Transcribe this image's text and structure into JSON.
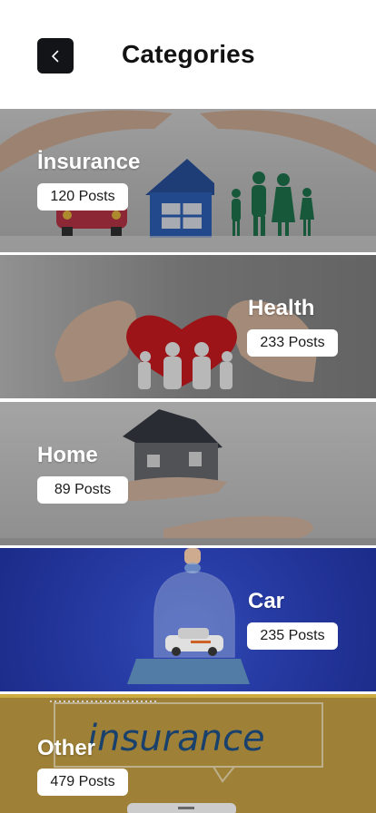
{
  "header": {
    "title": "Categories",
    "back_icon": "chevron-left-icon"
  },
  "categories": [
    {
      "name": "İnsurance",
      "posts": "120 Posts",
      "bg": "#cfcfcf"
    },
    {
      "name": "Health",
      "posts": "233 Posts",
      "bg": "#a8a8a8"
    },
    {
      "name": "Home",
      "posts": "89 Posts",
      "bg": "#c9c9c9"
    },
    {
      "name": "Car",
      "posts": "235 Posts",
      "bg": "#243aa7"
    },
    {
      "name": "Other",
      "posts": "479 Posts",
      "bg": "#a88a3f",
      "illustration_text": "insurance"
    }
  ],
  "colors": {
    "accent_dark": "#121418",
    "badge_bg": "#ffffff",
    "title_text": "#121212"
  }
}
